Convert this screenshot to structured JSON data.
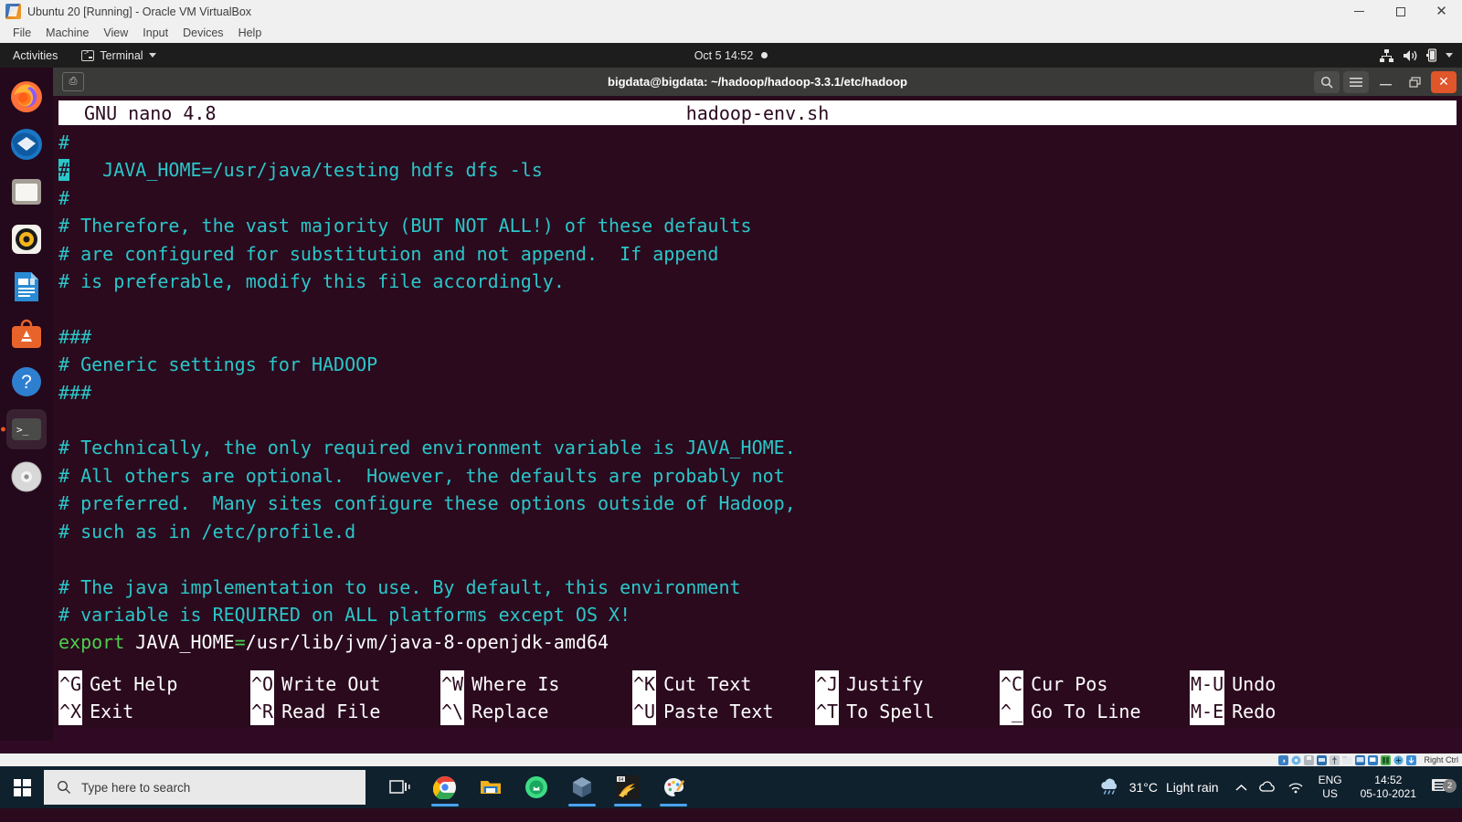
{
  "vbox": {
    "title": "Ubuntu 20 [Running] - Oracle VM VirtualBox",
    "icon": "virtualbox-icon",
    "menus": [
      "File",
      "Machine",
      "View",
      "Input",
      "Devices",
      "Help"
    ],
    "window_buttons": [
      "minimize",
      "maximize",
      "close"
    ],
    "host_key": "Right Ctrl",
    "status_icons": [
      "hdd-icon",
      "optical-disk-icon",
      "floppy-icon",
      "network-icon",
      "usb-icon",
      "shared-folder-icon",
      "display-icon",
      "remote-desktop-icon",
      "recording-icon",
      "mouse-integration-icon",
      "keyboard-icon"
    ]
  },
  "gnome": {
    "activities": "Activities",
    "app_menu": "Terminal",
    "app_icon": "terminal-icon",
    "clock": "Oct 5  14:52",
    "notification_dot": "●",
    "tray_icons": [
      "network-icon",
      "volume-icon",
      "battery-icon",
      "chevron-down-icon"
    ]
  },
  "dock": {
    "items": [
      {
        "name": "firefox",
        "label": "Firefox",
        "active": false
      },
      {
        "name": "thunderbird",
        "label": "Thunderbird Mail",
        "active": false
      },
      {
        "name": "files",
        "label": "Files",
        "active": false
      },
      {
        "name": "rhythmbox",
        "label": "Rhythmbox",
        "active": false
      },
      {
        "name": "libreoffice-writer",
        "label": "LibreOffice Writer",
        "active": false
      },
      {
        "name": "ubuntu-software",
        "label": "Ubuntu Software",
        "active": false
      },
      {
        "name": "help",
        "label": "Help",
        "active": false
      },
      {
        "name": "terminal",
        "label": "Terminal",
        "active": true
      },
      {
        "name": "disk-image",
        "label": "Disks",
        "active": false
      }
    ]
  },
  "terminal": {
    "title": "bigdata@bigdata: ~/hadoop/hadoop-3.3.1/etc/hadoop",
    "new_tab_icon": "new-tab-icon",
    "buttons": [
      "search-icon",
      "hamburger-menu-icon",
      "minimize",
      "maximize",
      "close"
    ]
  },
  "nano": {
    "version": "GNU nano 4.8",
    "filename": "hadoop-env.sh",
    "lines": [
      {
        "segments": [
          {
            "t": "#",
            "c": "cmt"
          }
        ]
      },
      {
        "segments": [
          {
            "t": "#",
            "c": "cursor"
          },
          {
            "t": "   JAVA_HOME=/usr/java/testing hdfs dfs -ls",
            "c": "cmt"
          }
        ]
      },
      {
        "segments": [
          {
            "t": "#",
            "c": "cmt"
          }
        ]
      },
      {
        "segments": [
          {
            "t": "# Therefore, the vast majority (BUT NOT ALL!) of these defaults",
            "c": "cmt"
          }
        ]
      },
      {
        "segments": [
          {
            "t": "# are configured for substitution and not append.  If append",
            "c": "cmt"
          }
        ]
      },
      {
        "segments": [
          {
            "t": "# is preferable, modify this file accordingly.",
            "c": "cmt"
          }
        ]
      },
      {
        "segments": [
          {
            "t": "",
            "c": "cmt"
          }
        ]
      },
      {
        "segments": [
          {
            "t": "###",
            "c": "cmt"
          }
        ]
      },
      {
        "segments": [
          {
            "t": "# Generic settings for HADOOP",
            "c": "cmt"
          }
        ]
      },
      {
        "segments": [
          {
            "t": "###",
            "c": "cmt"
          }
        ]
      },
      {
        "segments": [
          {
            "t": "",
            "c": "cmt"
          }
        ]
      },
      {
        "segments": [
          {
            "t": "# Technically, the only required environment variable is JAVA_HOME.",
            "c": "cmt"
          }
        ]
      },
      {
        "segments": [
          {
            "t": "# All others are optional.  However, the defaults are probably not",
            "c": "cmt"
          }
        ]
      },
      {
        "segments": [
          {
            "t": "# preferred.  Many sites configure these options outside of Hadoop,",
            "c": "cmt"
          }
        ]
      },
      {
        "segments": [
          {
            "t": "# such as in /etc/profile.d",
            "c": "cmt"
          }
        ]
      },
      {
        "segments": [
          {
            "t": "",
            "c": "cmt"
          }
        ]
      },
      {
        "segments": [
          {
            "t": "# The java implementation to use. By default, this environment",
            "c": "cmt"
          }
        ]
      },
      {
        "segments": [
          {
            "t": "# variable is REQUIRED on ALL platforms except OS X!",
            "c": "cmt"
          }
        ]
      },
      {
        "segments": [
          {
            "t": "export",
            "c": "kw"
          },
          {
            "t": " JAVA_HOME",
            "c": "wht"
          },
          {
            "t": "=",
            "c": "kw"
          },
          {
            "t": "/usr/lib/jvm/java-8-openjdk-amd64",
            "c": "wht"
          }
        ]
      }
    ],
    "shortcuts_row1": [
      {
        "key": "^G",
        "label": "Get Help"
      },
      {
        "key": "^O",
        "label": "Write Out"
      },
      {
        "key": "^W",
        "label": "Where Is"
      },
      {
        "key": "^K",
        "label": "Cut Text"
      },
      {
        "key": "^J",
        "label": "Justify"
      },
      {
        "key": "^C",
        "label": "Cur Pos"
      },
      {
        "key": "M-U",
        "label": "Undo"
      }
    ],
    "shortcuts_row2": [
      {
        "key": "^X",
        "label": "Exit"
      },
      {
        "key": "^R",
        "label": "Read File"
      },
      {
        "key": "^\\",
        "label": "Replace"
      },
      {
        "key": "^U",
        "label": "Paste Text"
      },
      {
        "key": "^T",
        "label": "To Spell"
      },
      {
        "key": "^_",
        "label": "Go To Line"
      },
      {
        "key": "M-E",
        "label": "Redo"
      }
    ]
  },
  "taskbar": {
    "start_label": "Start",
    "search_placeholder": "Type here to search",
    "search_icon": "search-icon",
    "apps": [
      {
        "name": "task-view",
        "label": "Task View",
        "running": false
      },
      {
        "name": "google-chrome",
        "label": "Google Chrome",
        "running": true
      },
      {
        "name": "file-explorer",
        "label": "File Explorer",
        "running": false
      },
      {
        "name": "android-studio",
        "label": "Android Studio",
        "running": false
      },
      {
        "name": "virtualbox",
        "label": "Oracle VM VirtualBox",
        "running": true
      },
      {
        "name": "winrar",
        "label": "WinRAR",
        "running": true
      },
      {
        "name": "paint",
        "label": "Paint",
        "running": true
      }
    ],
    "weather": {
      "icon": "cloud-rain-icon",
      "temperature": "31°C",
      "condition": "Light rain"
    },
    "tray": [
      "show-hidden-icons-chevron",
      "onedrive-icon",
      "wifi-icon"
    ],
    "language": {
      "line1": "ENG",
      "line2": "US"
    },
    "clock": {
      "time": "14:52",
      "date": "05-10-2021"
    },
    "notifications": {
      "icon": "notification-icon",
      "count": "2"
    }
  },
  "colors": {
    "terminal_bg": "#2b0a1e",
    "comment_teal": "#2ac7c9",
    "keyword_green": "#4ccf4c",
    "ubuntu_orange": "#e95420",
    "taskbar_bg": "#10212e",
    "accent_blue": "#4aa3ee"
  }
}
